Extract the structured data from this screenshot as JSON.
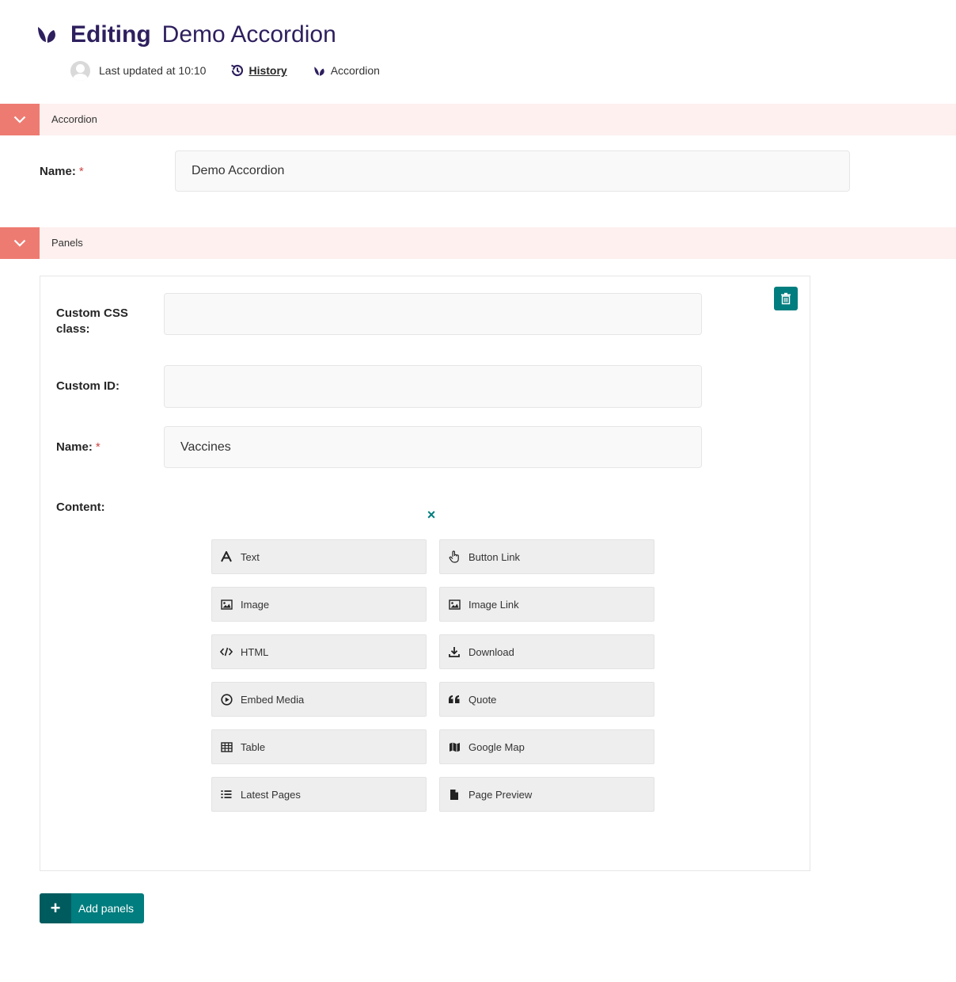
{
  "header": {
    "editing_label": "Editing",
    "page_name": "Demo Accordion",
    "last_updated": "Last updated at 10:10",
    "history_label": "History",
    "type_label": "Accordion"
  },
  "sections": {
    "accordion": {
      "label": "Accordion"
    },
    "panels": {
      "label": "Panels"
    }
  },
  "accordion_form": {
    "name_label": "Name:",
    "required_mark": "*",
    "name_value": "Demo Accordion"
  },
  "panel": {
    "css_class_label": "Custom CSS class:",
    "css_class_value": "",
    "custom_id_label": "Custom ID:",
    "custom_id_value": "",
    "name_label": "Name:",
    "required_mark": "*",
    "name_value": "Vaccines",
    "content_label": "Content:",
    "close_glyph": "×"
  },
  "block_choices": [
    {
      "label": "Text",
      "icon": "text-icon"
    },
    {
      "label": "Button Link",
      "icon": "pointer-hand-icon"
    },
    {
      "label": "Image",
      "icon": "image-icon"
    },
    {
      "label": "Image Link",
      "icon": "image-icon"
    },
    {
      "label": "HTML",
      "icon": "code-icon"
    },
    {
      "label": "Download",
      "icon": "download-icon"
    },
    {
      "label": "Embed Media",
      "icon": "media-play-icon"
    },
    {
      "label": "Quote",
      "icon": "quote-icon"
    },
    {
      "label": "Table",
      "icon": "table-icon"
    },
    {
      "label": "Google Map",
      "icon": "map-icon"
    },
    {
      "label": "Latest Pages",
      "icon": "list-icon"
    },
    {
      "label": "Page Preview",
      "icon": "document-icon"
    }
  ],
  "add_panels": {
    "plus": "+",
    "label": "Add panels"
  },
  "colors": {
    "brand_dark": "#2e1f5e",
    "accent_teal": "#007d7e",
    "section_toggle": "#ee7b71",
    "section_bg": "#fdf0ef"
  }
}
